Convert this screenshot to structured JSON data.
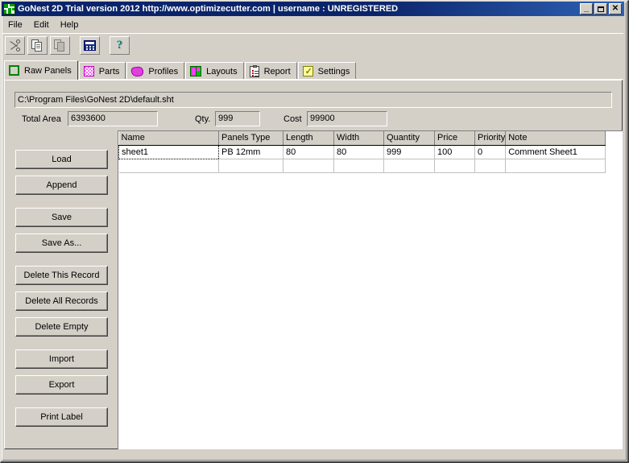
{
  "window": {
    "title": "GoNest 2D Trial version  2012  http://www.optimizecutter.com | username : UNREGISTERED",
    "icon": "app-grid-icon",
    "minimize_label": "_",
    "maximize_label": "",
    "close_label": "✕"
  },
  "menu": {
    "items": [
      {
        "label": "File"
      },
      {
        "label": "Edit"
      },
      {
        "label": "Help"
      }
    ]
  },
  "toolbar": {
    "buttons": [
      {
        "name": "cut-button",
        "icon": "scissors-icon",
        "enabled": true
      },
      {
        "name": "copy-button",
        "icon": "copy-icon",
        "enabled": true
      },
      {
        "name": "paste-button",
        "icon": "paste-icon",
        "enabled": false
      },
      {
        "name": "calculator-button",
        "icon": "calculator-icon",
        "enabled": true
      },
      {
        "name": "help-button",
        "icon": "question-mark-icon",
        "enabled": true,
        "glyph": "?"
      }
    ]
  },
  "tabs": [
    {
      "label": "Raw Panels",
      "icon": "green-square-icon",
      "active": true
    },
    {
      "label": "Parts",
      "icon": "magenta-checkered-square-icon",
      "active": false
    },
    {
      "label": "Profiles",
      "icon": "magenta-blob-icon",
      "active": false
    },
    {
      "label": "Layouts",
      "icon": "layout-icon",
      "active": false
    },
    {
      "label": "Report",
      "icon": "clipboard-icon",
      "active": false
    },
    {
      "label": "Settings",
      "icon": "yellow-checkbox-icon",
      "active": false
    }
  ],
  "main": {
    "file_path": "C:\\Program Files\\GoNest 2D\\default.sht",
    "stats": [
      {
        "label": "Total Area",
        "value": "6393600"
      },
      {
        "label": "Qty.",
        "value": "999"
      },
      {
        "label": "Cost",
        "value": "99900"
      }
    ],
    "buttons": [
      {
        "label": "Load"
      },
      {
        "label": "Append"
      },
      {
        "label": "Save"
      },
      {
        "label": "Save As..."
      },
      {
        "label": "Delete This Record"
      },
      {
        "label": "Delete All Records"
      },
      {
        "label": "Delete Empty"
      },
      {
        "label": "Import"
      },
      {
        "label": "Export"
      },
      {
        "label": "Print Label"
      }
    ],
    "table": {
      "columns": [
        "Name",
        "Panels Type",
        "Length",
        "Width",
        "Quantity",
        "Price",
        "Priority",
        "Note"
      ],
      "rows": [
        [
          "sheet1",
          "PB  12mm",
          "80",
          "80",
          "999",
          "100",
          "0",
          "Comment Sheet1"
        ],
        [
          "",
          "",
          "",
          "",
          "",
          "",
          "",
          ""
        ]
      ]
    }
  },
  "colors": {
    "title_bar": "#0a246a",
    "face": "#d4d0c8",
    "accent_green": "#008000",
    "accent_magenta": "#ff40ff",
    "grid_bg": "#ffffff"
  }
}
